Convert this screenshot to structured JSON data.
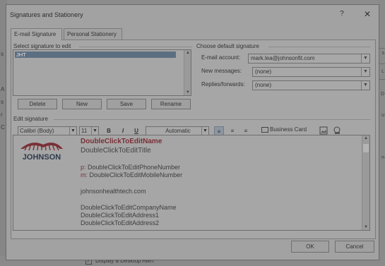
{
  "background": {
    "left_letters": [
      "s",
      "A",
      "s",
      "r",
      "C"
    ],
    "right_texts": [
      "s",
      "L",
      "D",
      "u",
      "n"
    ],
    "desktop_alert_label": "Display a Desktop Alert"
  },
  "dialog": {
    "title": "Signatures and Stationery",
    "help_glyph": "?",
    "close_glyph": "✕",
    "tabs": [
      {
        "label": "E-mail Signature",
        "active": true
      },
      {
        "label": "Personal Stationery",
        "active": false
      }
    ]
  },
  "select_signature": {
    "label": "Select signature to edit",
    "items": [
      "JHT"
    ],
    "buttons": {
      "delete": "Delete",
      "new": "New",
      "save": "Save",
      "rename": "Rename"
    }
  },
  "default_signature": {
    "label": "Choose default signature",
    "email_account_label": "E-mail account:",
    "email_account_value": "mark.lea@johnsonfit.com",
    "new_messages_label": "New messages:",
    "new_messages_value": "(none)",
    "replies_label": "Replies/forwards:",
    "replies_value": "(none)"
  },
  "edit_signature": {
    "label": "Edit signature",
    "font": "Calibri (Body)",
    "size": "11",
    "bold": "B",
    "italic": "I",
    "underline": "U",
    "color": "Automatic",
    "business_card": "Business Card",
    "content": {
      "logo_text": "JOHNSON",
      "name": "DoubleClickToEditName",
      "title": "DoubleClickToEditTitle",
      "phone_prefix": "p:",
      "phone": "DoubleClickToEditPhoneNumber",
      "mobile_prefix": "m:",
      "mobile": "DoubleClickToEditMobileNumber",
      "website": "johnsonhealthtech.com",
      "company": "DoubleClickToEditCompanyName",
      "address1": "DoubleClickToEditAddress1",
      "address2": "DoubleClickToEditAddress2"
    }
  },
  "footer": {
    "ok": "OK",
    "cancel": "Cancel"
  },
  "colors": {
    "accent_name": "#7a2f36",
    "selection": "#5c6f82"
  }
}
